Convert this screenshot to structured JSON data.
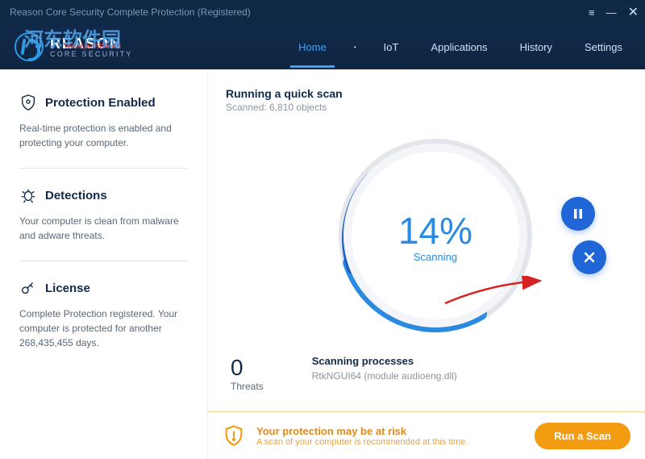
{
  "window": {
    "title": "Reason Core Security Complete Protection (Registered)"
  },
  "brand": {
    "line1": "REASON",
    "line2": "CORE SECURITY"
  },
  "nav": {
    "items": [
      {
        "label": "Home",
        "active": true
      },
      {
        "label": "IoT"
      },
      {
        "label": "Applications"
      },
      {
        "label": "History"
      },
      {
        "label": "Settings"
      }
    ]
  },
  "sidebar": {
    "protection": {
      "title": "Protection Enabled",
      "desc": "Real-time protection is enabled and protecting your computer."
    },
    "detections": {
      "title": "Detections",
      "desc": "Your computer is clean from malware and adware threats."
    },
    "license": {
      "title": "License",
      "desc": "Complete Protection registered. Your computer is protected for another 268,435,455 days."
    }
  },
  "scan": {
    "title": "Running a quick scan",
    "subtitle": "Scanned: 6,810 objects",
    "percent_text": "14%",
    "percent_value": 14,
    "status": "Scanning",
    "threats_count": "0",
    "threats_label": "Threats",
    "process_heading": "Scanning processes",
    "process_current": "RtkNGUI64 (module audioeng.dll)"
  },
  "risk": {
    "title": "Your protection may be at risk",
    "subtitle": "A scan of your computer is recommended at this time.",
    "button": "Run a Scan"
  },
  "colors": {
    "accent": "#2b8be0",
    "navy": "#112a4a",
    "warn": "#f39c12"
  }
}
